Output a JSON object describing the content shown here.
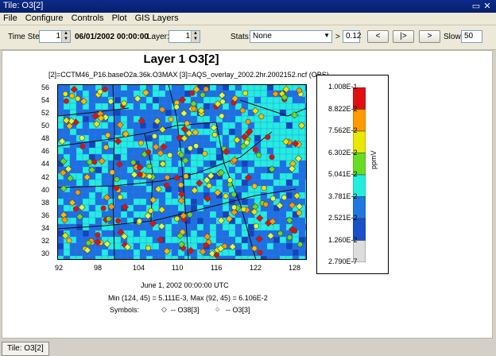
{
  "window": {
    "title": "Tile: O3[2]"
  },
  "menu": {
    "items": [
      "File",
      "Configure",
      "Controls",
      "Plot",
      "GIS Layers"
    ]
  },
  "toolbar": {
    "timestep_label": "Time Step:",
    "timestep_value": "1",
    "datetime": "06/01/2002 00:00:00",
    "layer_label": "Layer:",
    "layer_value": "1",
    "stats_label": "Stats:",
    "stats_value": "None",
    "gt_symbol": ">",
    "threshold": "0.12",
    "btn_prev": "<",
    "btn_play": "|>",
    "btn_next": ">",
    "slow_label": "Slow:",
    "slow_value": "50"
  },
  "plot": {
    "title": "Layer 1 O3[2]",
    "subtitle": "[2]=CCTM46_P16.baseO2a.36k.O3MAX  [3]=AQS_overlay_2002.2hr.2002152.ncf (OBS)",
    "time": "June 1, 2002 00:00:00 UTC",
    "minmax": "Min (124, 45) = 5.111E-3, Max (92, 45) = 6.106E-2",
    "symbols_label": "Symbols:",
    "symbol1": "-- O38[3]",
    "symbol2": "-- O3[3]",
    "y_ticks": [
      "56",
      "54",
      "52",
      "50",
      "48",
      "46",
      "44",
      "42",
      "40",
      "38",
      "36",
      "34",
      "32",
      "30"
    ],
    "x_ticks": [
      "92",
      "98",
      "104",
      "110",
      "116",
      "122",
      "128"
    ],
    "legend_unit": "ppmV",
    "legend_ticks": [
      "1.008E-1",
      "8.822E-2",
      "7.562E-2",
      "6.302E-2",
      "5.041E-2",
      "3.781E-2",
      "2.521E-2",
      "1.260E-2",
      "2.790E-7"
    ],
    "legend_colors": [
      "#e01010",
      "#ff9a00",
      "#e8e800",
      "#66dd22",
      "#22eedd",
      "#1e78e0",
      "#1a50c8",
      "#dddddd"
    ],
    "grid_colors": {
      "base": "#1e6fe0",
      "cyan": "#22eedd",
      "dark": "#1444b8"
    }
  },
  "status": {
    "tab": "Tile: O3[2]"
  }
}
